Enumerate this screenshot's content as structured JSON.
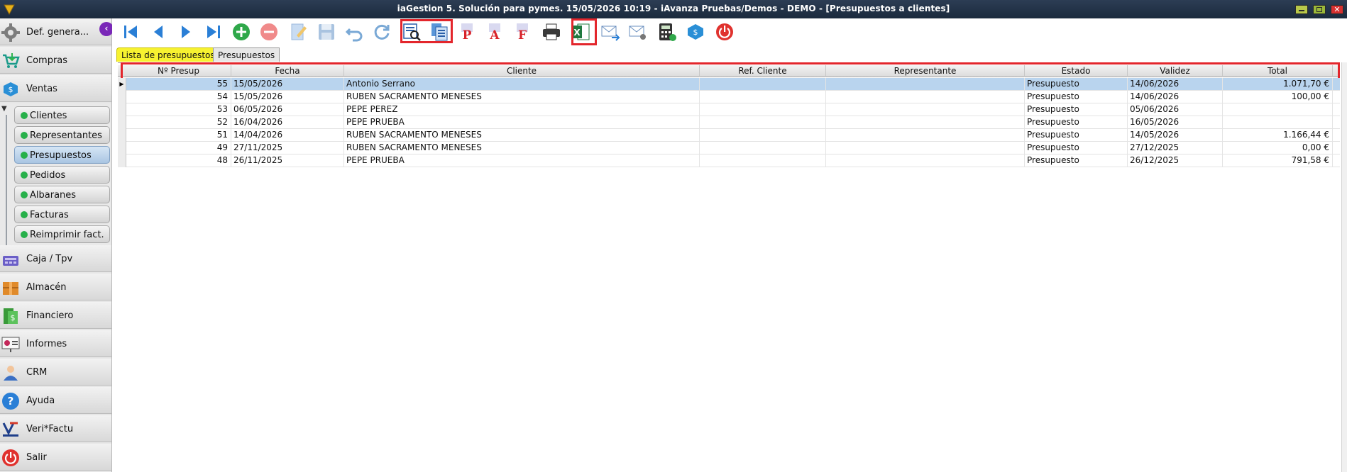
{
  "window": {
    "title": "iaGestion 5. Solución para pymes.   15/05/2026 10:19   -   iAvanza Pruebas/Demos - DEMO - [Presupuestos a clientes]"
  },
  "sidebar": {
    "top": [
      {
        "label": "Def. genera...",
        "icon": "gear-icon"
      },
      {
        "label": "Compras",
        "icon": "cart-icon"
      },
      {
        "label": "Ventas",
        "icon": "sales-icon"
      }
    ],
    "sub": [
      {
        "label": "Clientes"
      },
      {
        "label": "Representantes"
      },
      {
        "label": "Presupuestos",
        "active": true
      },
      {
        "label": "Pedidos"
      },
      {
        "label": "Albaranes"
      },
      {
        "label": "Facturas"
      },
      {
        "label": "Reimprimir fact."
      }
    ],
    "bottom": [
      {
        "label": "Caja / Tpv",
        "icon": "cash-register-icon"
      },
      {
        "label": "Almacén",
        "icon": "warehouse-icon"
      },
      {
        "label": "Financiero",
        "icon": "money-icon"
      },
      {
        "label": "Informes",
        "icon": "report-icon"
      },
      {
        "label": "CRM",
        "icon": "person-icon"
      },
      {
        "label": "Ayuda",
        "icon": "help-icon"
      },
      {
        "label": "Veri*Factu",
        "icon": "verifactu-logo-icon"
      },
      {
        "label": "Salir",
        "icon": "power-icon"
      }
    ]
  },
  "tabs": {
    "list": "Lista de presupuestos",
    "detail": "Presupuestos"
  },
  "grid": {
    "columns": [
      "Nº Presup",
      "Fecha",
      "Cliente",
      "Ref. Cliente",
      "Representante",
      "Estado",
      "Validez",
      "Total"
    ],
    "rows": [
      {
        "num": "55",
        "fecha": "15/05/2026",
        "cliente": "Antonio Serrano",
        "ref": "",
        "rep": "",
        "estado": "Presupuesto",
        "validez": "14/06/2026",
        "total": "1.071,70 €",
        "selected": true
      },
      {
        "num": "54",
        "fecha": "15/05/2026",
        "cliente": "RUBEN SACRAMENTO MENESES",
        "ref": "",
        "rep": "",
        "estado": "Presupuesto",
        "validez": "14/06/2026",
        "total": "100,00 €"
      },
      {
        "num": "53",
        "fecha": "06/05/2026",
        "cliente": "PEPE PEREZ",
        "ref": "",
        "rep": "",
        "estado": "Presupuesto",
        "validez": "05/06/2026",
        "total": ""
      },
      {
        "num": "52",
        "fecha": "16/04/2026",
        "cliente": "PEPE PRUEBA",
        "ref": "",
        "rep": "",
        "estado": "Presupuesto",
        "validez": "16/05/2026",
        "total": ""
      },
      {
        "num": "51",
        "fecha": "14/04/2026",
        "cliente": "RUBEN SACRAMENTO MENESES",
        "ref": "",
        "rep": "",
        "estado": "Presupuesto",
        "validez": "14/05/2026",
        "total": "1.166,44 €"
      },
      {
        "num": "49",
        "fecha": "27/11/2025",
        "cliente": "RUBEN SACRAMENTO MENESES",
        "ref": "",
        "rep": "",
        "estado": "Presupuesto",
        "validez": "27/12/2025",
        "total": "0,00 €"
      },
      {
        "num": "48",
        "fecha": "26/11/2025",
        "cliente": "PEPE PRUEBA",
        "ref": "",
        "rep": "",
        "estado": "Presupuesto",
        "validez": "26/12/2025",
        "total": "791,58 €"
      }
    ]
  },
  "toolbar": {
    "icons": [
      "first-record-icon",
      "previous-record-icon",
      "next-record-icon",
      "last-record-icon",
      "add-icon",
      "delete-icon",
      "edit-icon",
      "save-icon",
      "undo-icon",
      "refresh-icon",
      "search-document-icon",
      "document-list-icon",
      "pdf-p-icon",
      "pdf-a-icon",
      "pdf-f-icon",
      "printer-icon",
      "excel-icon",
      "send-mail-icon",
      "mail-settings-icon",
      "calculator-icon",
      "sales-tag-icon",
      "power-icon"
    ]
  },
  "colors": {
    "accent_red": "#e3262c",
    "tab_yellow": "#f7f230",
    "selection_blue": "#b9d4ee",
    "title_bar": "#1f2f44"
  }
}
